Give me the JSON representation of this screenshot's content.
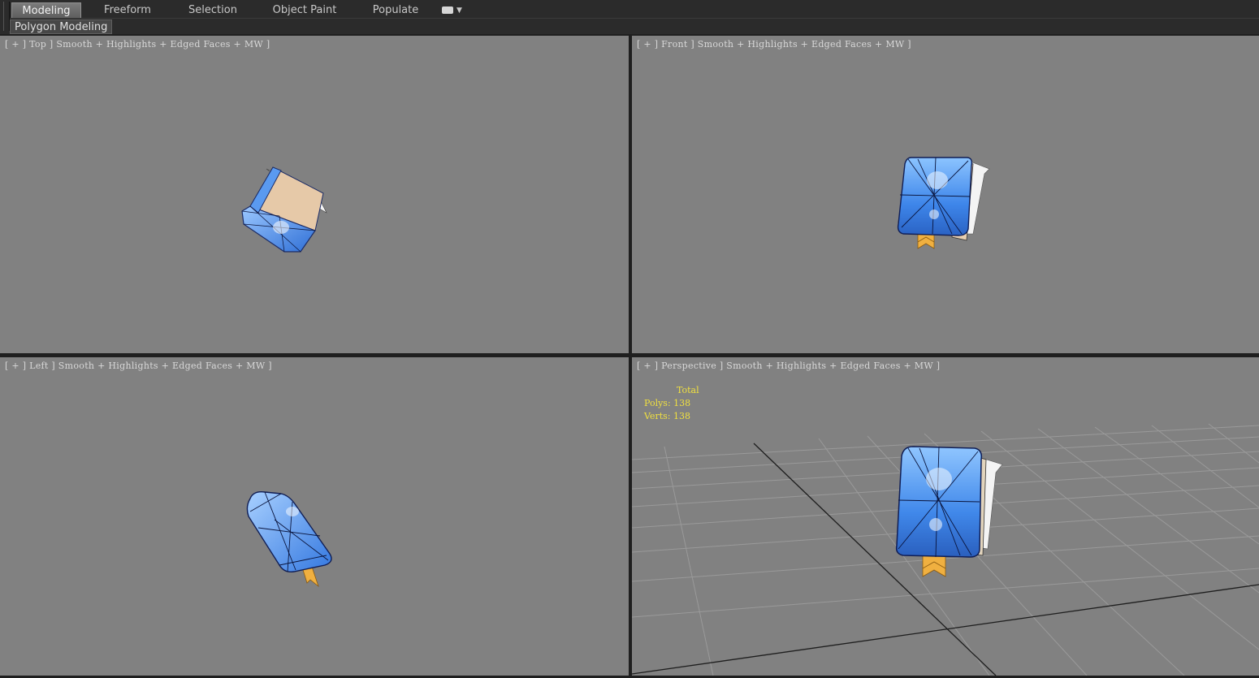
{
  "ribbon": {
    "tabs": [
      {
        "label": "Modeling",
        "active": true
      },
      {
        "label": "Freeform",
        "active": false
      },
      {
        "label": "Selection",
        "active": false
      },
      {
        "label": "Object Paint",
        "active": false
      },
      {
        "label": "Populate",
        "active": false
      }
    ],
    "panel_label": "Polygon Modeling"
  },
  "viewports": {
    "top": {
      "label": "[ + ] Top ] Smooth + Highlights + Edged Faces + MW ]"
    },
    "front": {
      "label": "[ + ] Front ] Smooth + Highlights + Edged Faces + MW ]"
    },
    "left": {
      "label": "[ + ] Left ] Smooth + Highlights + Edged Faces + MW ]"
    },
    "perspective": {
      "label": "[ + ] Perspective ] Smooth + Highlights + Edged Faces + MW ]",
      "stats": {
        "total": "Total",
        "polys": "Polys: 138",
        "verts": "Verts: 138"
      }
    }
  },
  "colors": {
    "viewport_bg": "#818181",
    "stats_text": "#f0e040",
    "model_blue": "#5aa0f0"
  }
}
